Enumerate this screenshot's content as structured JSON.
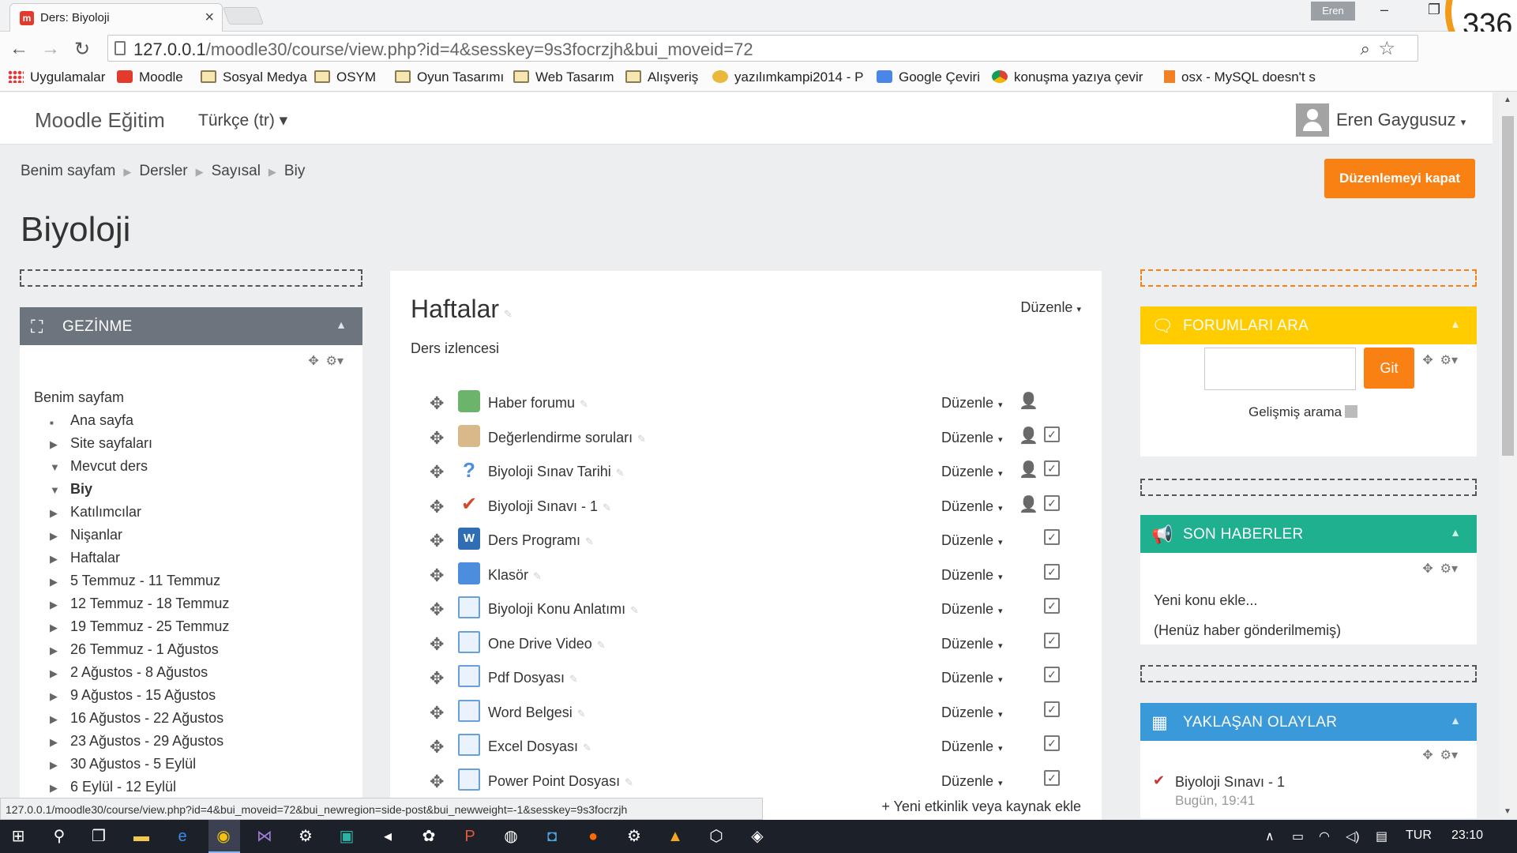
{
  "browser": {
    "tab_title": "Ders: Biyoloji",
    "tab_favicon": "m",
    "window_user": "Eren",
    "badge_text": "336",
    "url_host": "127.0.0.1",
    "url_path": "/moodle30/course/view.php?id=4&sesskey=9s3focrzjh&bui_moveid=72",
    "bookmarks": [
      {
        "label": "Uygulamalar",
        "icon": "apps-icon"
      },
      {
        "label": "Moodle",
        "icon": "moodle-icon"
      },
      {
        "label": "Sosyal Medya",
        "icon": "folder-icon"
      },
      {
        "label": "OSYM",
        "icon": "folder-icon"
      },
      {
        "label": "Oyun Tasarımı",
        "icon": "folder-icon"
      },
      {
        "label": "Web Tasarım",
        "icon": "folder-icon"
      },
      {
        "label": "Alışveriş",
        "icon": "folder-icon"
      },
      {
        "label": "yazılımkampi2014 - P",
        "icon": "web-icon"
      },
      {
        "label": "Google Çeviri",
        "icon": "translate-icon"
      },
      {
        "label": "konuşma yazıya çevir",
        "icon": "chrome-icon"
      },
      {
        "label": "osx - MySQL doesn't s",
        "icon": "stack-icon"
      }
    ],
    "status_url": "127.0.0.1/moodle30/course/view.php?id=4&bui_moveid=72&bui_newregion=side-post&bui_newweight=-1&sesskey=9s3focrzjh"
  },
  "navbar": {
    "brand": "Moodle Eğitim",
    "language": "Türkçe (tr)",
    "user": "Eren Gaygusuz"
  },
  "breadcrumb": [
    "Benim sayfam",
    "Dersler",
    "Sayısal",
    "Biy"
  ],
  "edit_button": "Düzenlemeyi kapat",
  "page_title": "Biyoloji",
  "navigation_block": {
    "title": "GEZİNME",
    "tree": [
      {
        "label": "Benim sayfam",
        "level": 0,
        "marker": ""
      },
      {
        "label": "Ana sayfa",
        "level": 1,
        "marker": "■"
      },
      {
        "label": "Site sayfaları",
        "level": 1,
        "marker": "▶"
      },
      {
        "label": "Mevcut ders",
        "level": 1,
        "marker": "▼"
      },
      {
        "label": "Biy",
        "level": 2,
        "marker": "▼",
        "bold": true
      },
      {
        "label": "Katılımcılar",
        "level": 3,
        "marker": "▶"
      },
      {
        "label": "Nişanlar",
        "level": 3,
        "marker": "▶"
      },
      {
        "label": "Haftalar",
        "level": 3,
        "marker": "▶"
      },
      {
        "label": "5 Temmuz - 11 Temmuz",
        "level": 3,
        "marker": "▶"
      },
      {
        "label": "12 Temmuz - 18 Temmuz",
        "level": 3,
        "marker": "▶"
      },
      {
        "label": "19 Temmuz - 25 Temmuz",
        "level": 3,
        "marker": "▶"
      },
      {
        "label": "26 Temmuz - 1 Ağustos",
        "level": 3,
        "marker": "▶"
      },
      {
        "label": "2 Ağustos - 8 Ağustos",
        "level": 3,
        "marker": "▶"
      },
      {
        "label": "9 Ağustos - 15 Ağustos",
        "level": 3,
        "marker": "▶"
      },
      {
        "label": "16 Ağustos - 22 Ağustos",
        "level": 3,
        "marker": "▶"
      },
      {
        "label": "23 Ağustos - 29 Ağustos",
        "level": 3,
        "marker": "▶"
      },
      {
        "label": "30 Ağustos - 5 Eylül",
        "level": 3,
        "marker": "▶"
      },
      {
        "label": "6 Eylül - 12 Eylül",
        "level": 3,
        "marker": "▶"
      }
    ]
  },
  "section": {
    "title": "Haftalar",
    "edit_label": "Düzenle",
    "subtitle": "Ders izlencesi",
    "activities": [
      {
        "name": "Haber forumu",
        "icon": "forum-icon",
        "edit": "Düzenle",
        "user": true,
        "check": false
      },
      {
        "name": "Değerlendirme soruları",
        "icon": "feedback-icon",
        "edit": "Düzenle",
        "user": true,
        "check": true
      },
      {
        "name": "Biyoloji Sınav Tarihi",
        "icon": "question-icon",
        "edit": "Düzenle",
        "user": true,
        "check": true
      },
      {
        "name": "Biyoloji Sınavı - 1",
        "icon": "quiz-icon",
        "edit": "Düzenle",
        "user": true,
        "check": true
      },
      {
        "name": "Ders Programı",
        "icon": "word-icon",
        "edit": "Düzenle",
        "user": false,
        "check": true
      },
      {
        "name": "Klasör",
        "icon": "folder-icon",
        "edit": "Düzenle",
        "user": false,
        "check": true
      },
      {
        "name": "Biyoloji Konu Anlatımı",
        "icon": "page-icon",
        "edit": "Düzenle",
        "user": false,
        "check": true
      },
      {
        "name": "One Drive Video",
        "icon": "page-icon",
        "edit": "Düzenle",
        "user": false,
        "check": true
      },
      {
        "name": "Pdf Dosyası",
        "icon": "page-icon",
        "edit": "Düzenle",
        "user": false,
        "check": true
      },
      {
        "name": "Word Belgesi",
        "icon": "page-icon",
        "edit": "Düzenle",
        "user": false,
        "check": true
      },
      {
        "name": "Excel Dosyası",
        "icon": "page-icon",
        "edit": "Düzenle",
        "user": false,
        "check": true
      },
      {
        "name": "Power Point Dosyası",
        "icon": "page-icon",
        "edit": "Düzenle",
        "user": false,
        "check": true
      }
    ],
    "add_activity": "Yeni etkinlik veya kaynak ekle"
  },
  "forum_search_block": {
    "title": "FORUMLARI ARA",
    "color": "#ffcc00",
    "go_button": "Git",
    "advanced": "Gelişmiş arama"
  },
  "news_block": {
    "title": "SON HABERLER",
    "color": "#1fb090",
    "add_topic": "Yeni konu ekle...",
    "empty": "(Henüz haber gönderilmemiş)"
  },
  "events_block": {
    "title": "YAKLAŞAN OLAYLAR",
    "color": "#3a9ad9",
    "event_name": "Biyoloji Sınavı - 1",
    "event_time": "Bugün, 19:41"
  },
  "taskbar": {
    "language": "TUR",
    "clock": "23:10"
  },
  "colors": {
    "accent": "#f98012",
    "nav_block_header": "#6c757d"
  }
}
